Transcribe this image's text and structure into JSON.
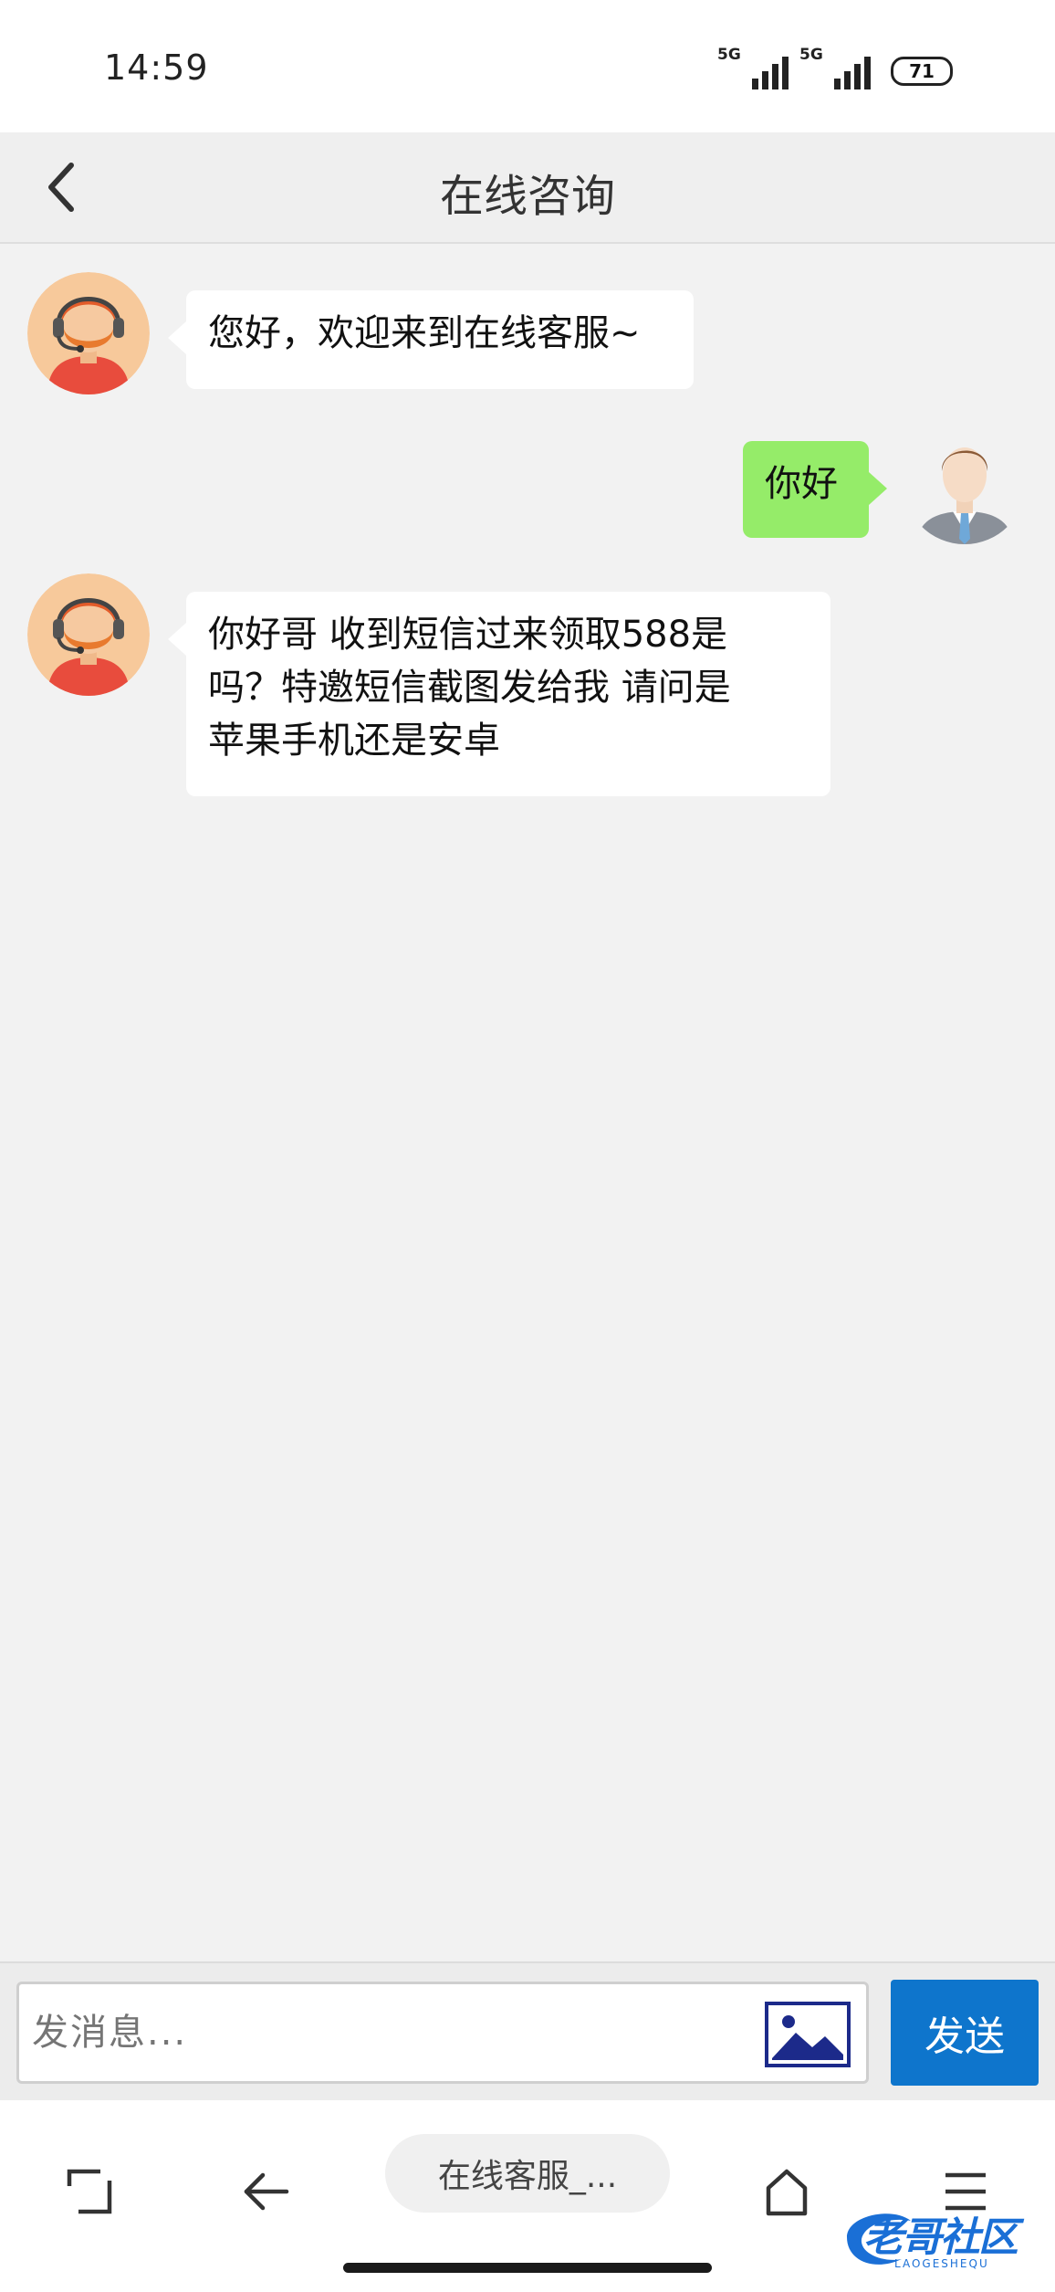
{
  "status": {
    "time": "14:59",
    "sim1_tag": "5G",
    "sim2_tag": "5G",
    "battery": "71"
  },
  "header": {
    "title": "在线咨询",
    "back_icon": "chevron-left-icon"
  },
  "messages": [
    {
      "side": "left",
      "avatar": "agent-avatar",
      "text": "您好，欢迎来到在线客服~"
    },
    {
      "side": "right",
      "avatar": "user-avatar",
      "text": "你好"
    },
    {
      "side": "left",
      "avatar": "agent-avatar",
      "lines": [
        "你好哥 收到短信过来领取588是",
        "吗？特邀短信截图发给我 请问是",
        "苹果手机还是安卓"
      ]
    }
  ],
  "input": {
    "placeholder": "发消息...",
    "image_icon": "image-icon",
    "send_label": "发送"
  },
  "browser_nav": {
    "tabs_icon": "tabs-icon",
    "back_icon": "arrow-left-icon",
    "url_label": "在线客服_...",
    "home_icon": "home-icon",
    "menu_icon": "menu-icon"
  },
  "watermark": {
    "text": "老哥社区",
    "sub": "LAOGESHEQU"
  },
  "colors": {
    "send_button": "#0e75cc",
    "user_bubble": "#95ec69",
    "background": "#f2f2f2"
  }
}
